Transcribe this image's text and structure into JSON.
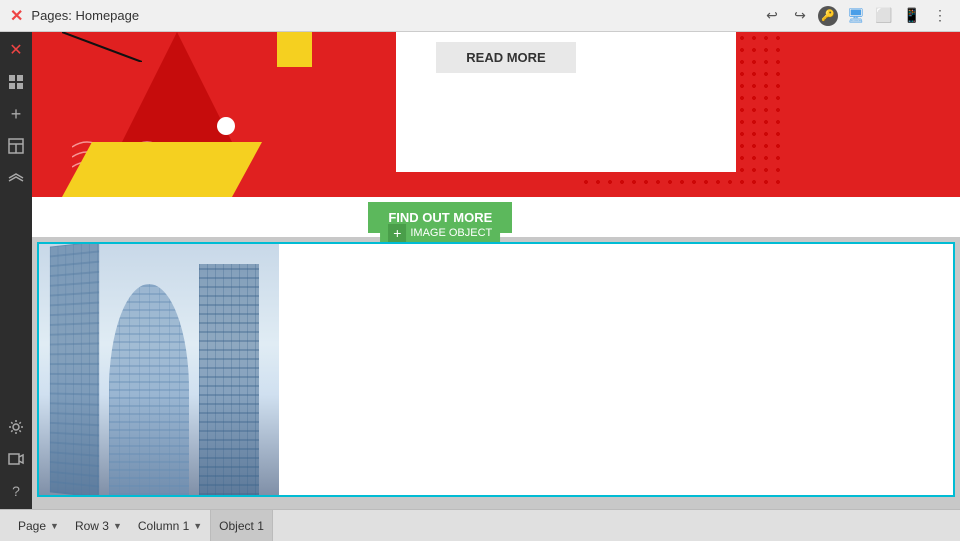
{
  "topbar": {
    "title": "Pages: Homepage",
    "icons": [
      "undo",
      "redo",
      "key-shield",
      "desktop",
      "tablet",
      "mobile",
      "more"
    ]
  },
  "sidebar": {
    "icons": [
      {
        "name": "close-x",
        "label": "Close"
      },
      {
        "name": "grid-icon",
        "label": "Grid"
      },
      {
        "name": "add-icon",
        "label": "Add"
      },
      {
        "name": "layout-icon",
        "label": "Layout"
      },
      {
        "name": "layers-icon",
        "label": "Layers"
      },
      {
        "name": "settings-icon",
        "label": "Settings"
      },
      {
        "name": "video-icon",
        "label": "Video"
      },
      {
        "name": "help-icon",
        "label": "Help"
      }
    ]
  },
  "hero": {
    "read_more_label": "READ MORE"
  },
  "find_out": {
    "button_label": "FIND OUT MORE",
    "object_label": "IMAGE OBJECT"
  },
  "statusbar": {
    "page_label": "Page",
    "row_label": "Row 3",
    "column_label": "Column 1",
    "object_label": "Object 1"
  }
}
